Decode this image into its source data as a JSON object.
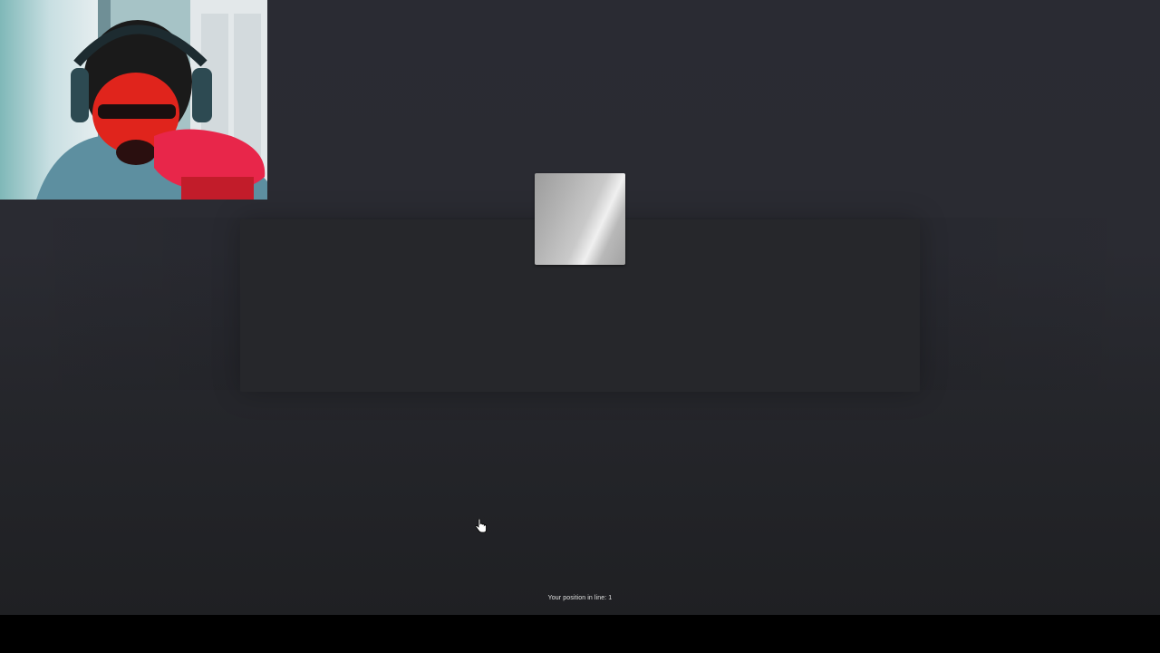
{
  "queue": {
    "status_text": "Your position in line: 1"
  },
  "webcam": {
    "icon": "person-video-feed"
  },
  "cursor": {
    "icon": "hand-pointer-icon"
  },
  "colors": {
    "background": "#2a2b33",
    "panel": "#26272b",
    "bottom_bar": "#000000",
    "text": "#e2e2e2"
  }
}
